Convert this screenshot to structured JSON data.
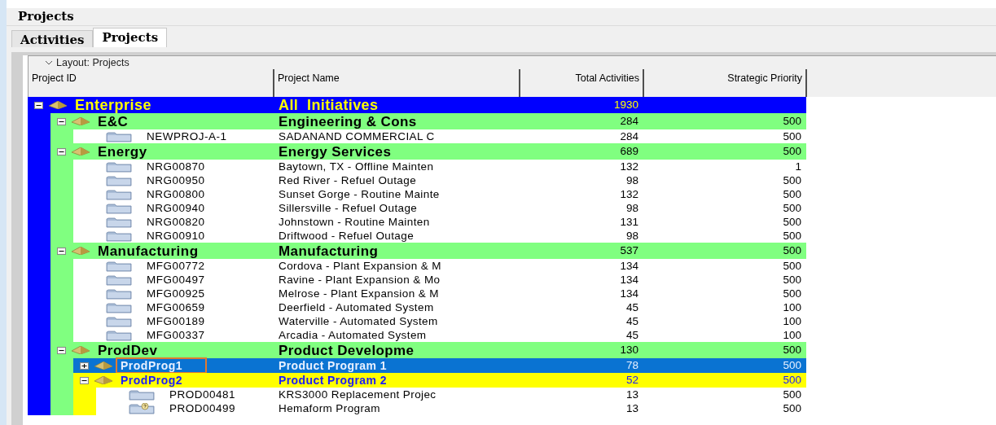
{
  "window": {
    "title": "Projects"
  },
  "tabs": [
    {
      "label": "Activities",
      "selected": false
    },
    {
      "label": "Projects",
      "selected": true
    }
  ],
  "layout": {
    "label": "Layout: Projects"
  },
  "table": {
    "columns": [
      "Project ID",
      "Project Name",
      "Total Activities",
      "Strategic Priority"
    ],
    "rows": [
      {
        "kind": "eps",
        "color": "#0000ff",
        "id": "Enterprise",
        "name": "All  Initiatives",
        "total": "1930",
        "expanded": true,
        "selected": false,
        "children": [
          {
            "kind": "eps",
            "color": "#80ff80",
            "id": "E&C",
            "name": "Engineering & Cons",
            "total": "284",
            "priority": "500",
            "expanded": true,
            "selected": false,
            "children": [
              {
                "kind": "project",
                "id": "NEWPROJ-A-1",
                "name": "SADANAND COMMERCIAL C",
                "total": "284",
                "priority": "500"
              }
            ]
          },
          {
            "kind": "eps",
            "color": "#80ff80",
            "id": "Energy",
            "name": "Energy Services",
            "total": "689",
            "priority": "500",
            "expanded": true,
            "selected": false,
            "children": [
              {
                "kind": "project",
                "id": "NRG00870",
                "name": "Baytown, TX - Offline Mainten",
                "total": "132",
                "priority": "1"
              },
              {
                "kind": "project",
                "id": "NRG00950",
                "name": "Red River - Refuel Outage",
                "total": "98",
                "priority": "500"
              },
              {
                "kind": "project",
                "id": "NRG00800",
                "name": "Sunset Gorge - Routine Mainte",
                "total": "132",
                "priority": "500"
              },
              {
                "kind": "project",
                "id": "NRG00940",
                "name": "Sillersville - Refuel Outage",
                "total": "98",
                "priority": "500"
              },
              {
                "kind": "project",
                "id": "NRG00820",
                "name": "Johnstown - Routine Mainten",
                "total": "131",
                "priority": "500"
              },
              {
                "kind": "project",
                "id": "NRG00910",
                "name": "Driftwood - Refuel Outage",
                "total": "98",
                "priority": "500"
              }
            ]
          },
          {
            "kind": "eps",
            "color": "#80ff80",
            "id": "Manufacturing",
            "name": "Manufacturing",
            "total": "537",
            "priority": "500",
            "expanded": true,
            "selected": false,
            "children": [
              {
                "kind": "project",
                "id": "MFG00772",
                "name": "Cordova - Plant Expansion & M",
                "total": "134",
                "priority": "500"
              },
              {
                "kind": "project",
                "id": "MFG00497",
                "name": "Ravine - Plant Expansion & Mo",
                "total": "134",
                "priority": "500"
              },
              {
                "kind": "project",
                "id": "MFG00925",
                "name": "Melrose - Plant Expansion & M",
                "total": "134",
                "priority": "500"
              },
              {
                "kind": "project",
                "id": "MFG00659",
                "name": "Deerfield - Automated System",
                "total": "45",
                "priority": "100"
              },
              {
                "kind": "project",
                "id": "MFG00189",
                "name": "Waterville - Automated System",
                "total": "45",
                "priority": "100"
              },
              {
                "kind": "project",
                "id": "MFG00337",
                "name": "Arcadia - Automated System",
                "total": "45",
                "priority": "100"
              }
            ]
          },
          {
            "kind": "eps",
            "color": "#80ff80",
            "id": "ProdDev",
            "name": "Product Developme",
            "total": "130",
            "priority": "500",
            "expanded": true,
            "selected": false,
            "children": [
              {
                "kind": "eps",
                "id": "ProdProg1",
                "name": "Product Program 1",
                "total": "78",
                "priority": "500",
                "expanded": false,
                "selected": true
              },
              {
                "kind": "eps",
                "color": "#ffff00",
                "id": "ProdProg2",
                "name": "Product Program 2",
                "total": "52",
                "priority": "500",
                "expanded": true,
                "selected": false,
                "children": [
                  {
                    "kind": "project",
                    "id": "PROD00481",
                    "name": "KRS3000 Replacement Projec",
                    "total": "13",
                    "priority": "500"
                  },
                  {
                    "kind": "project-whatif",
                    "id": "PROD00499",
                    "name": "Hemaform Program",
                    "total": "13",
                    "priority": "500"
                  }
                ]
              }
            ]
          }
        ]
      }
    ]
  }
}
